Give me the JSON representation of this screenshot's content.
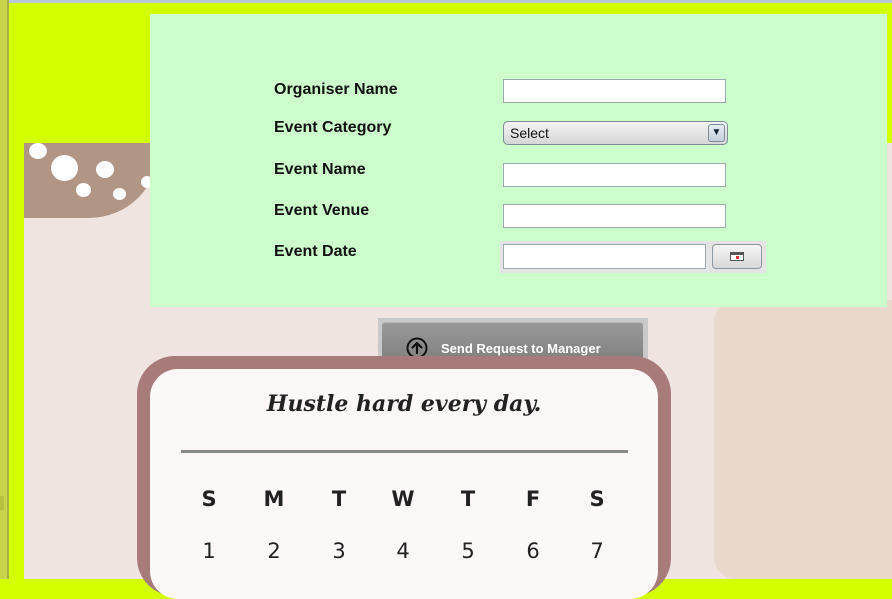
{
  "form": {
    "labels": {
      "organiser_name": "Organiser Name",
      "event_category": "Event Category",
      "event_name": "Event Name",
      "event_venue": "Event Venue",
      "event_date": "Event Date"
    },
    "values": {
      "organiser_name": "",
      "event_name": "",
      "event_venue": "",
      "event_date": ""
    },
    "category_selected": "Select",
    "dropdown_arrow": "▼"
  },
  "request_button": {
    "label": "Send Request to Manager",
    "icon": "arrow-up-circle-icon"
  },
  "calendar": {
    "motto": "Hustle hard every day.",
    "weekdays": [
      "S",
      "M",
      "T",
      "W",
      "T",
      "F",
      "S"
    ],
    "days": [
      "1",
      "2",
      "3",
      "4",
      "5",
      "6",
      "7"
    ]
  },
  "colors": {
    "window_background": "#d4ff00",
    "form_background": "#ccffcc",
    "calendar_border": "#a87b7b",
    "button_gray": "#888888"
  }
}
